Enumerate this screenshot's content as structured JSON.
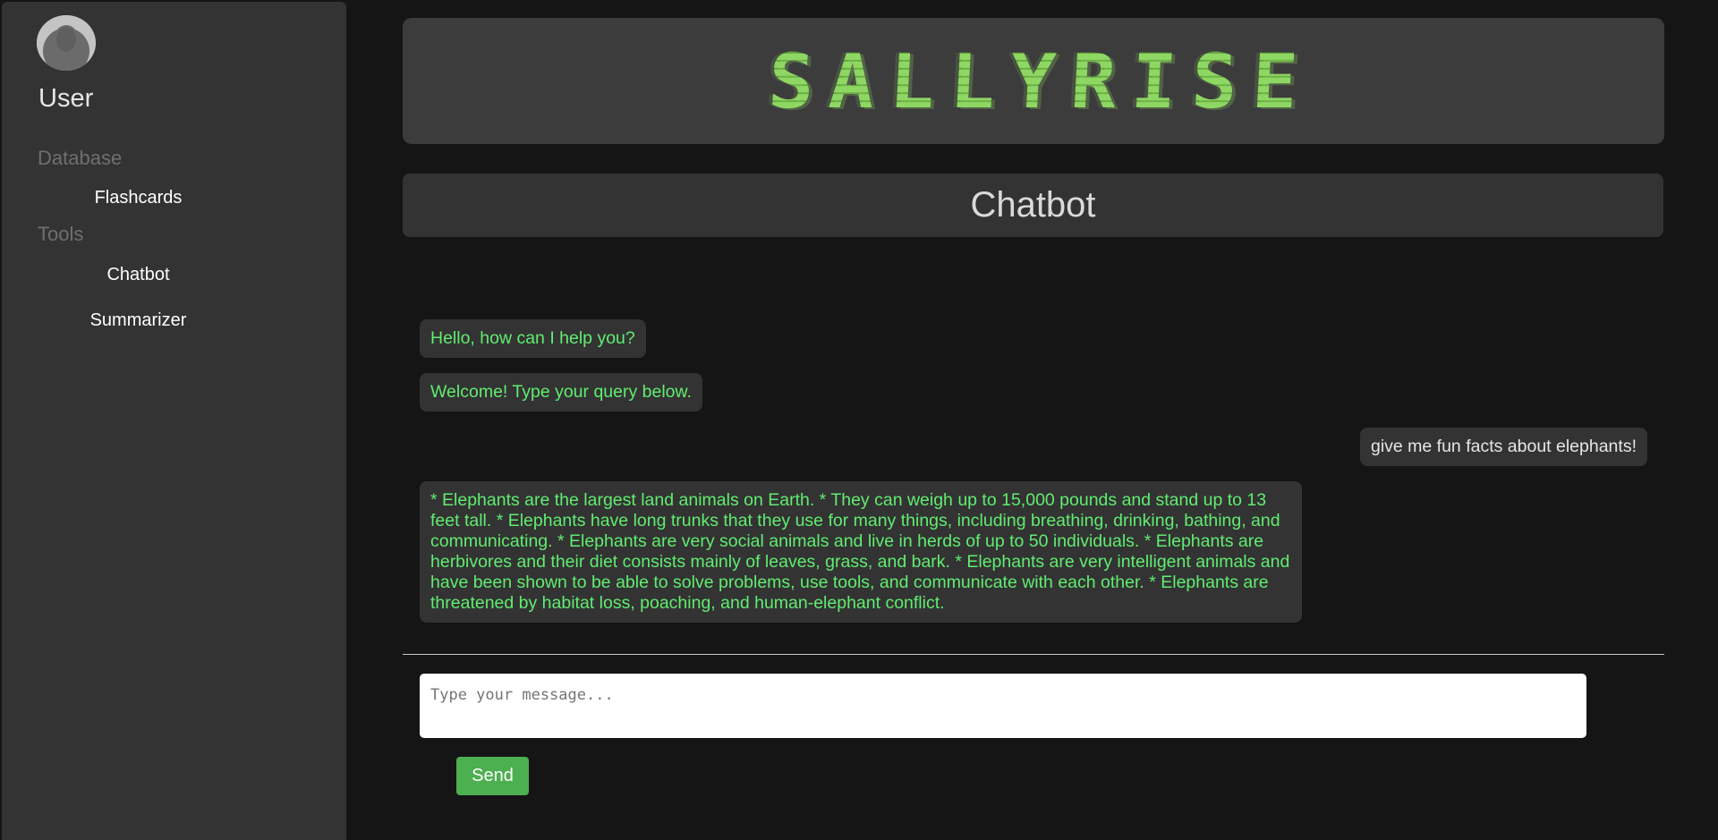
{
  "sidebar": {
    "user_name": "User",
    "sections": [
      {
        "label": "Database",
        "items": [
          {
            "label": "Flashcards"
          }
        ]
      },
      {
        "label": "Tools",
        "items": [
          {
            "label": "Chatbot"
          },
          {
            "label": "Summarizer"
          }
        ]
      }
    ]
  },
  "header": {
    "logo_text": "SALLYRISE",
    "page_title": "Chatbot"
  },
  "chat": {
    "messages": [
      {
        "role": "bot",
        "text": "Hello, how can I help you?"
      },
      {
        "role": "bot",
        "text": "Welcome! Type your query below."
      },
      {
        "role": "user",
        "text": "give me fun facts about elephants!"
      },
      {
        "role": "bot",
        "text": "* Elephants are the largest land animals on Earth. * They can weigh up to 15,000 pounds and stand up to 13 feet tall. * Elephants have long trunks that they use for many things, including breathing, drinking, bathing, and communicating. * Elephants are very social animals and live in herds of up to 50 individuals. * Elephants are herbivores and their diet consists mainly of leaves, grass, and bark. * Elephants are very intelligent animals and have been shown to be able to solve problems, use tools, and communicate with each other. * Elephants are threatened by habitat loss, poaching, and human-elephant conflict."
      }
    ]
  },
  "composer": {
    "value": "",
    "placeholder": "Type your message...",
    "send_label": "Send"
  },
  "colors": {
    "background": "#151515",
    "panel": "#333333",
    "logo_green": "#8fd863",
    "bot_text": "#60ed70",
    "send_button": "#4caf50"
  },
  "icons": {
    "avatar": "user-silhouette-icon"
  }
}
